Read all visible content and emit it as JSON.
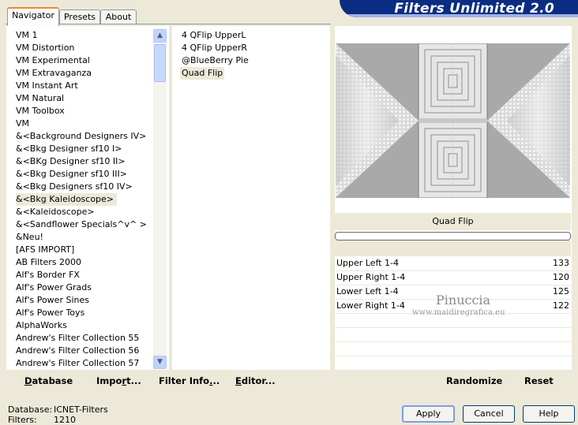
{
  "window": {
    "title": "Filters Unlimited 2.0"
  },
  "tabs": [
    {
      "label": "Navigator"
    },
    {
      "label": "Presets"
    },
    {
      "label": "About"
    }
  ],
  "categories": [
    "VM 1",
    "VM Distortion",
    "VM Experimental",
    "VM Extravaganza",
    "VM Instant Art",
    "VM Natural",
    "VM Toolbox",
    "VM",
    "&<Background Designers IV>",
    "&<Bkg Designer sf10 I>",
    "&<BKg Designer sf10 II>",
    "&<Bkg Designer sf10 III>",
    "&<Bkg Designers sf10 IV>",
    "&<Bkg Kaleidoscope>",
    "&<Kaleidoscope>",
    "&<Sandflower Specials^v^ >",
    "&Neu!",
    "[AFS IMPORT]",
    "AB Filters 2000",
    "Alf's Border FX",
    "Alf's Power Grads",
    "Alf's Power Sines",
    "Alf's Power Toys",
    "AlphaWorks",
    "Andrew's Filter Collection 55",
    "Andrew's Filter Collection 56",
    "Andrew's Filter Collection 57"
  ],
  "selected_category": "&<Bkg Kaleidoscope>",
  "filters": [
    "4 QFlip UpperL",
    "4 QFlip UpperR",
    "@BlueBerry Pie",
    "Quad Flip"
  ],
  "selected_filter": "Quad Flip",
  "preview": {
    "filter_name": "Quad Flip",
    "progress": 0
  },
  "parameters": [
    {
      "label": "Upper Left 1-4",
      "value": "133"
    },
    {
      "label": "Upper Right 1-4",
      "value": "120"
    },
    {
      "label": "Lower Left 1-4",
      "value": "125"
    },
    {
      "label": "Lower Right 1-4",
      "value": "122"
    }
  ],
  "watermark": {
    "name": "Pinuccia",
    "url": "www.maidiregrafica.eu"
  },
  "toolbar": {
    "database": "Database",
    "import": "Import...",
    "filter_info": "Filter Info...",
    "editor": "Editor...",
    "randomize": "Randomize",
    "reset": "Reset"
  },
  "status": {
    "database_label": "Database:",
    "database_value": "ICNET-Filters",
    "filters_label": "Filters:",
    "filters_value": "1210"
  },
  "buttons": {
    "apply": "Apply",
    "cancel": "Cancel",
    "help": "Help"
  },
  "colors": {
    "banner": "#0a2d82",
    "tab_accent": "#e68b2c",
    "dialog_bg": "#ece9d8"
  }
}
